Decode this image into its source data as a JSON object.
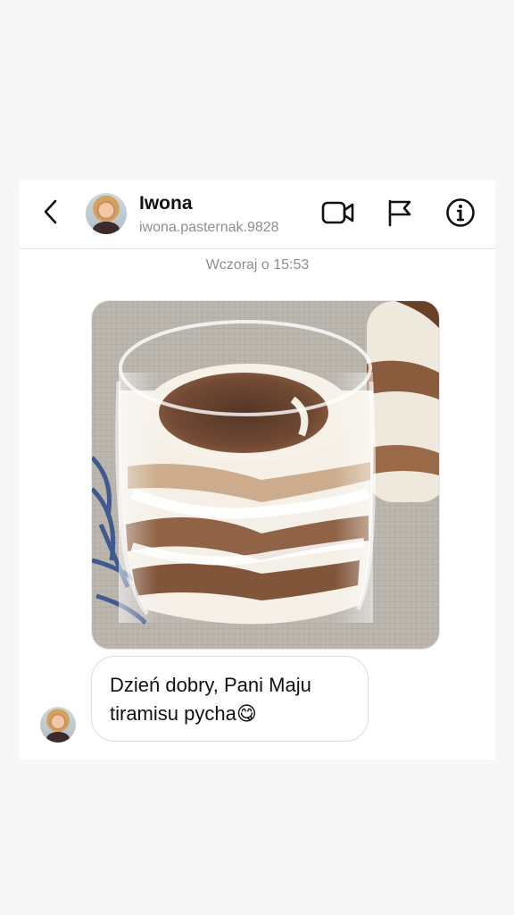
{
  "header": {
    "name": "Iwona",
    "username": "iwona.pasternak.9828"
  },
  "icons": {
    "back": "chevron-left-icon",
    "video": "video-camera-icon",
    "report": "flag-icon",
    "info": "info-circle-icon"
  },
  "conversation": {
    "timestamp": "Wczoraj o 15:53",
    "photo_message": {
      "description_icon": "photo"
    },
    "text_message": {
      "line1": "Dzień dobry, Pani Maju",
      "line2": "tiramisu pycha😋"
    }
  }
}
